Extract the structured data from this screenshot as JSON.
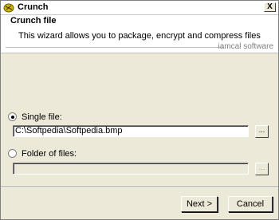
{
  "window": {
    "title": "Crunch",
    "close_label": "X"
  },
  "header": {
    "title": "Crunch file",
    "description": "This wizard allows you to package, encrypt and compress files",
    "brand": "iamcal software"
  },
  "options": {
    "single_file": {
      "label": "Single file:",
      "selected": true,
      "value": "C:\\Softpedia\\Softpedia.bmp",
      "browse_label": "..."
    },
    "folder": {
      "label": "Folder of files:",
      "selected": false,
      "value": "",
      "browse_label": "..."
    }
  },
  "buttons": {
    "next": "Next >",
    "cancel": "Cancel"
  },
  "icons": {
    "app": "crunch-app-icon",
    "close": "close-icon"
  }
}
